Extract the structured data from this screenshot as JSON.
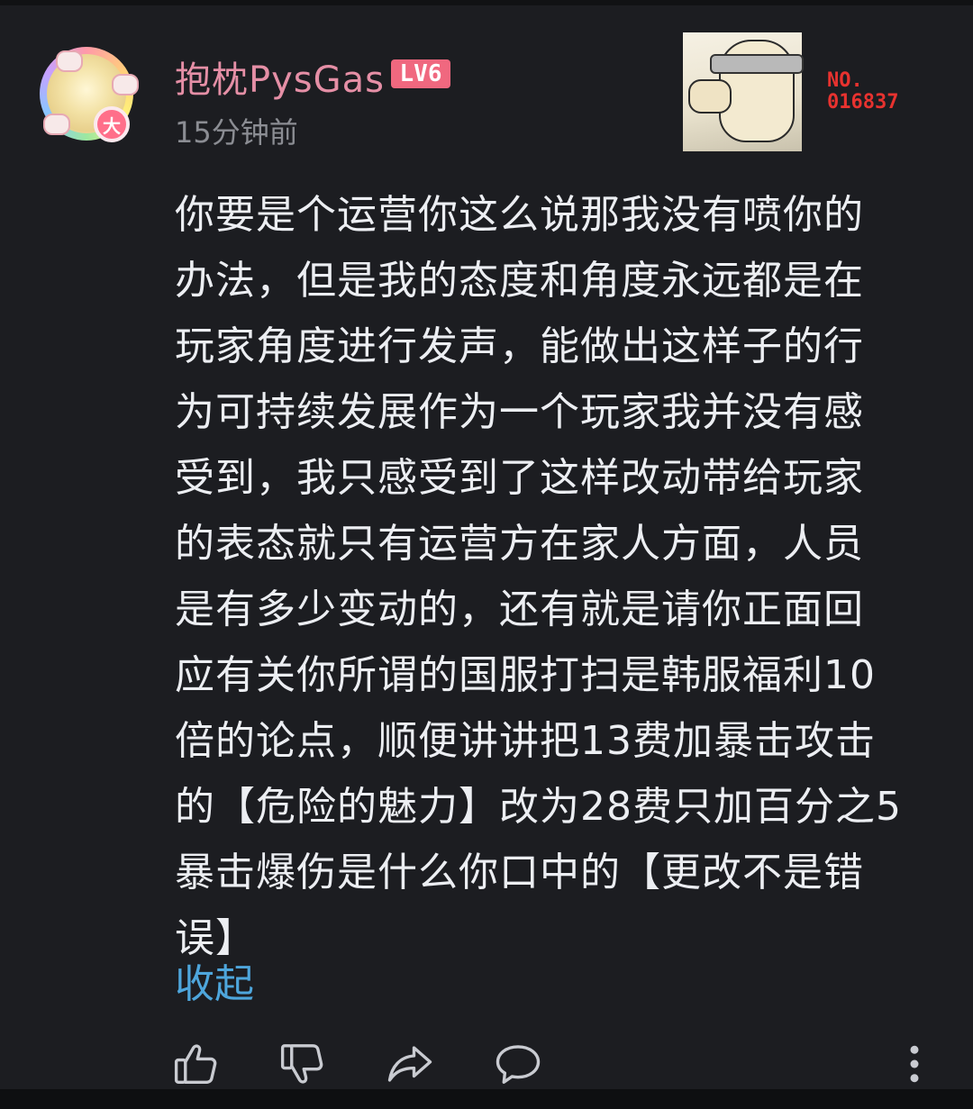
{
  "user": {
    "name": "抱枕PysGas",
    "level": "LV6",
    "avatar_badge": "大",
    "time_ago": "15分钟前"
  },
  "decoration": {
    "number_label": "NO.",
    "number_value": "016837"
  },
  "comment": {
    "lines": [
      "你要是个运营你这么说那我没有喷你的",
      "办法，但是我的态度和角度永远都是在",
      "玩家角度进行发声，能做出这样子的行",
      "为可持续发展作为一个玩家我并没有感",
      "受到，我只感受到了这样改动带给玩家",
      "的表态就只有运营方在家人方面，人员",
      "是有多少变动的，还有就是请你正面回",
      "应有关你所谓的国服打扫是韩服福利10",
      "倍的论点，顺便讲讲把13费加暴击攻击",
      "的【危险的魅力】改为28费只加百分之5",
      "暴击爆伤是什么你口中的【更改不是错",
      "误】"
    ],
    "collapse_label": "收起"
  },
  "actions": {
    "icons": [
      "thumbs-up-icon",
      "thumbs-down-icon",
      "share-icon",
      "comment-icon",
      "more-icon"
    ]
  },
  "colors": {
    "background": "#1c1d21",
    "username": "#e58fa6",
    "level_badge": "#f0687f",
    "body_text": "#eceef2",
    "link": "#4ea6dc",
    "muted": "#8b8d93",
    "decor_number": "#e8322f"
  }
}
